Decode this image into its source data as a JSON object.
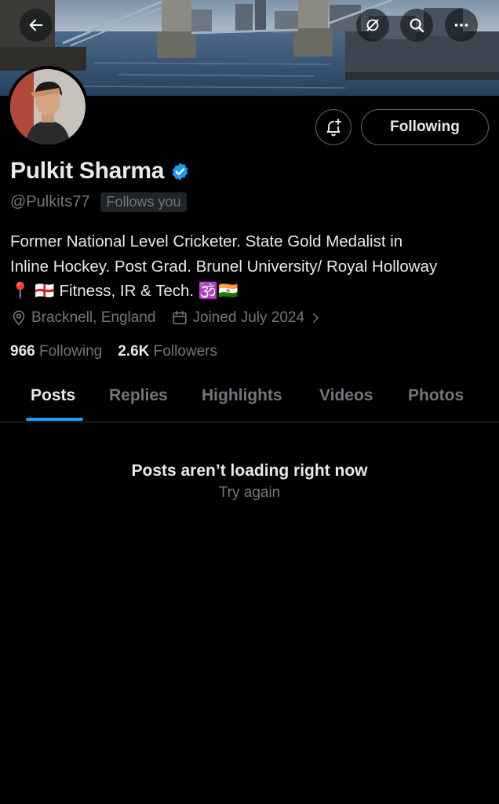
{
  "header": {
    "back_icon": "arrow-left-icon",
    "grok_icon": "grok-icon",
    "search_icon": "search-icon",
    "more_icon": "more-icon"
  },
  "profile": {
    "display_name": "Pulkit Sharma",
    "verified": true,
    "handle": "@Pulkits77",
    "follows_you": "Follows you",
    "bio_lines": [
      "Former National Level Cricketer. State Gold Medalist in",
      "Inline Hockey. Post Grad. Brunel University/ Royal Holloway",
      "📍 🏴󠁧󠁢󠁥󠁮󠁧󠁿 Fitness, IR & Tech. 🕉️🇮🇳"
    ],
    "location": "Bracknell, England",
    "joined": "Joined July 2024",
    "following_count": "966",
    "following_label": "Following",
    "followers_count": "2.6K",
    "followers_label": "Followers"
  },
  "actions": {
    "following_button": "Following",
    "notify_icon": "bell-plus-icon"
  },
  "tabs": [
    {
      "label": "Posts",
      "active": true
    },
    {
      "label": "Replies",
      "active": false
    },
    {
      "label": "Highlights",
      "active": false
    },
    {
      "label": "Videos",
      "active": false
    },
    {
      "label": "Photos",
      "active": false
    }
  ],
  "empty_state": {
    "title": "Posts aren’t loading right now",
    "retry": "Try again"
  },
  "colors": {
    "background": "#000000",
    "accent": "#1d9bf0",
    "text_primary": "#e7e9ea",
    "text_secondary": "#71767b"
  }
}
